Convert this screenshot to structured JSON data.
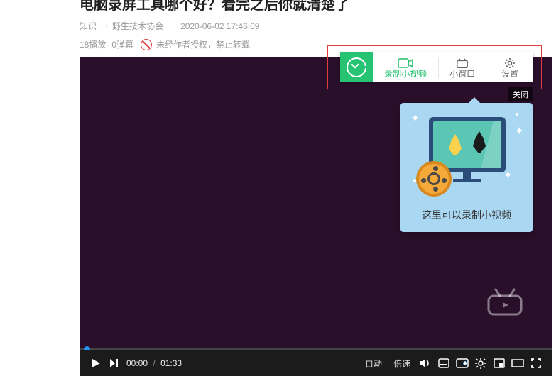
{
  "page_title": "电脑录屏工具哪个好？看完之后你就清楚了",
  "breadcrumb": {
    "cat1": "知识",
    "sep": "›",
    "cat2": "野生技术协会"
  },
  "timestamp": "2020-06-02 17:46:09",
  "stats": {
    "plays": "18播放",
    "dot": "·",
    "danmaku": "0弹幕"
  },
  "repost_warning": "未经作者授权，禁止转载",
  "player": {
    "current_time": "00:00",
    "duration": "01:33",
    "auto_label": "自动",
    "speed_label": "倍速"
  },
  "extension": {
    "record_label": "录制小视频",
    "pip_label": "小窗口",
    "settings_label": "设置"
  },
  "popover": {
    "close_label": "关闭",
    "caption": "这里可以录制小视频"
  }
}
